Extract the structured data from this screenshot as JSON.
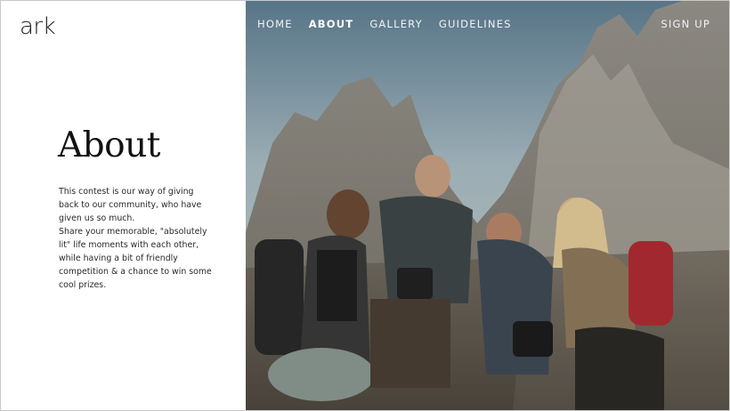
{
  "brand": {
    "logo_text": "ark"
  },
  "nav": {
    "items": [
      {
        "label": "HOME",
        "active": false
      },
      {
        "label": "ABOUT",
        "active": true
      },
      {
        "label": "GALLERY",
        "active": false
      },
      {
        "label": "GUIDELINES",
        "active": false
      }
    ],
    "signup_label": "SIGN UP"
  },
  "about": {
    "title": "About",
    "paragraph1": "This contest is our way of giving back to our community, who have given us so much.",
    "paragraph2": "Share your memorable, \"absolutely lit\" life moments with each other, while having a bit of friendly competition & a chance to win some cool prizes."
  },
  "hero": {
    "description_icon": "hikers-photo"
  }
}
